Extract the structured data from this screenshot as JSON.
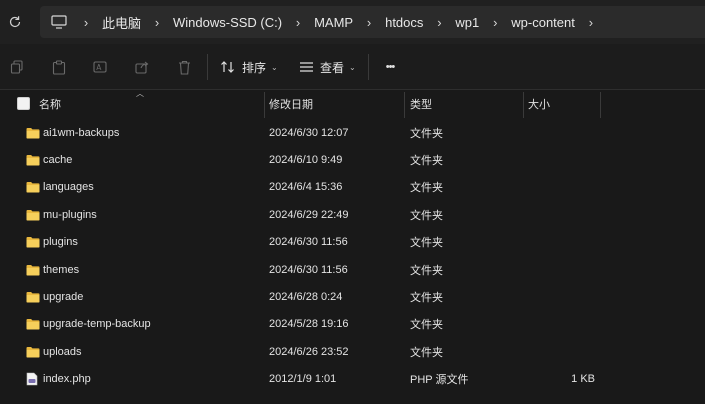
{
  "address": {
    "breadcrumbs": [
      "此电脑",
      "Windows-SSD (C:)",
      "MAMP",
      "htdocs",
      "wp1",
      "wp-content"
    ]
  },
  "toolbar": {
    "sort_label": "排序",
    "view_label": "查看",
    "more_label": "•••"
  },
  "columns": {
    "name": "名称",
    "date": "修改日期",
    "type": "类型",
    "size": "大小"
  },
  "files": [
    {
      "name": "ai1wm-backups",
      "date": "2024/6/30 12:07",
      "type": "文件夹",
      "size": "",
      "icon": "folder-icon"
    },
    {
      "name": "cache",
      "date": "2024/6/10 9:49",
      "type": "文件夹",
      "size": "",
      "icon": "folder-icon"
    },
    {
      "name": "languages",
      "date": "2024/6/4 15:36",
      "type": "文件夹",
      "size": "",
      "icon": "folder-icon"
    },
    {
      "name": "mu-plugins",
      "date": "2024/6/29 22:49",
      "type": "文件夹",
      "size": "",
      "icon": "folder-icon"
    },
    {
      "name": "plugins",
      "date": "2024/6/30 11:56",
      "type": "文件夹",
      "size": "",
      "icon": "folder-icon"
    },
    {
      "name": "themes",
      "date": "2024/6/30 11:56",
      "type": "文件夹",
      "size": "",
      "icon": "folder-icon"
    },
    {
      "name": "upgrade",
      "date": "2024/6/28 0:24",
      "type": "文件夹",
      "size": "",
      "icon": "folder-icon"
    },
    {
      "name": "upgrade-temp-backup",
      "date": "2024/5/28 19:16",
      "type": "文件夹",
      "size": "",
      "icon": "folder-icon"
    },
    {
      "name": "uploads",
      "date": "2024/6/26 23:52",
      "type": "文件夹",
      "size": "",
      "icon": "folder-icon"
    },
    {
      "name": "index.php",
      "date": "2012/1/9 1:01",
      "type": "PHP 源文件",
      "size": "1 KB",
      "icon": "php-file-icon"
    }
  ],
  "colors": {
    "background": "#191919",
    "folder": "#f2c94c",
    "text": "#e4e4e4"
  }
}
